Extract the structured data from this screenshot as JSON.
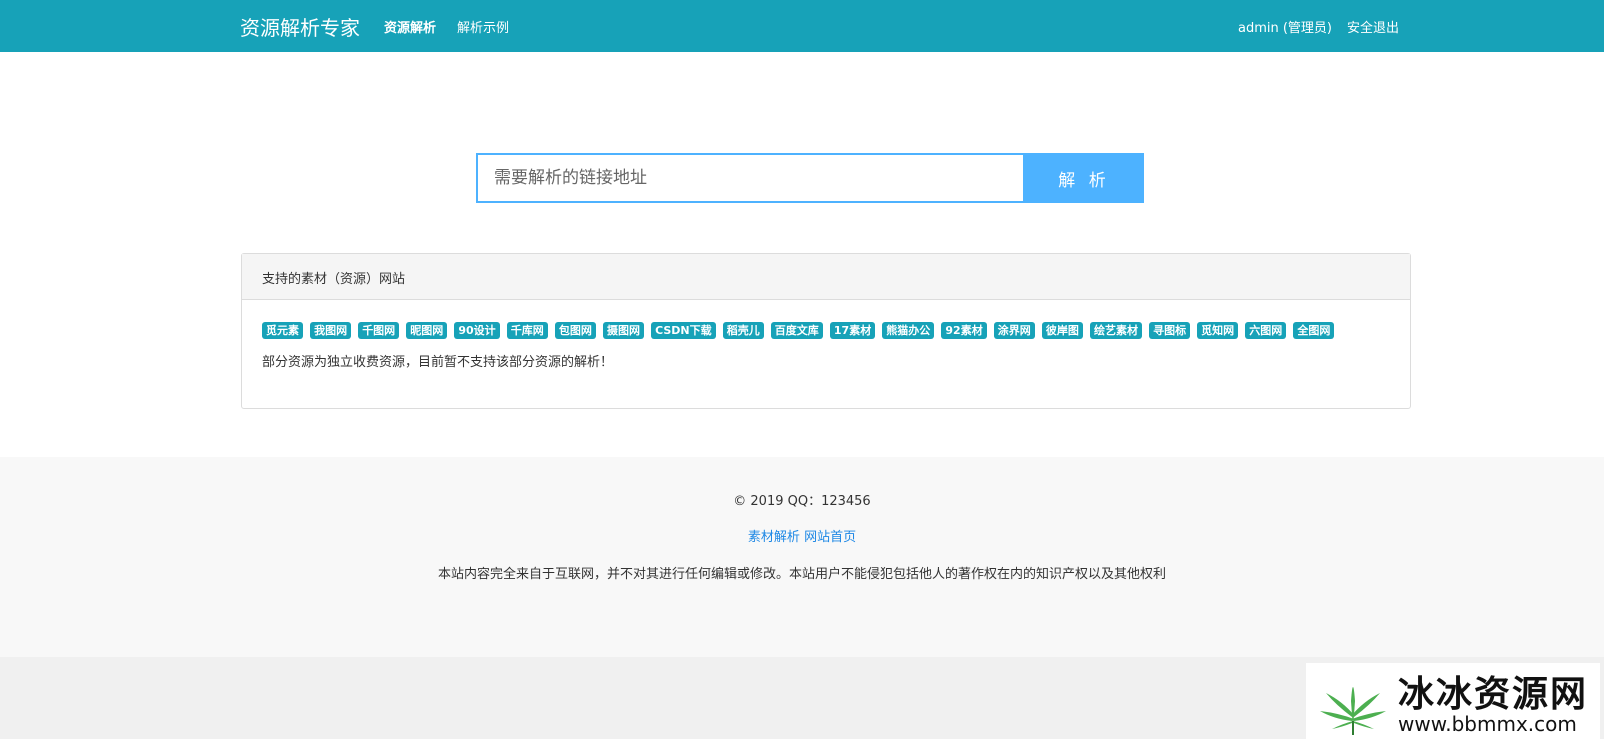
{
  "navbar": {
    "brand": "资源解析专家",
    "links": [
      "资源解析",
      "解析示例"
    ],
    "user": "admin (管理员)",
    "logout": "安全退出",
    "bg_color": "#17a2b8"
  },
  "search": {
    "placeholder": "需要解析的链接地址",
    "button_label": "解 析",
    "accent_color": "#4db2ff"
  },
  "supported": {
    "title": "支持的素材（资源）网站",
    "sites": [
      "觅元素",
      "我图网",
      "千图网",
      "昵图网",
      "90设计",
      "千库网",
      "包图网",
      "摄图网",
      "CSDN下载",
      "稻壳儿",
      "百度文库",
      "17素材",
      "熊猫办公",
      "92素材",
      "涂界网",
      "彼岸图",
      "绘艺素材",
      "寻图标",
      "觅知网",
      "六图网",
      "全图网"
    ],
    "notice": "部分资源为独立收费资源，目前暂不支持该部分资源的解析！"
  },
  "footer": {
    "copyright": "© 2019 QQ：123456",
    "links": [
      "素材解析",
      "网站首页"
    ],
    "disclaimer": "本站内容完全来自于互联网，并不对其进行任何编辑或修改。本站用户不能侵犯包括他人的著作权在内的知识产权以及其他权利"
  },
  "watermark": {
    "text": "冰冰资源网",
    "url": "www.bbmmx.com"
  }
}
